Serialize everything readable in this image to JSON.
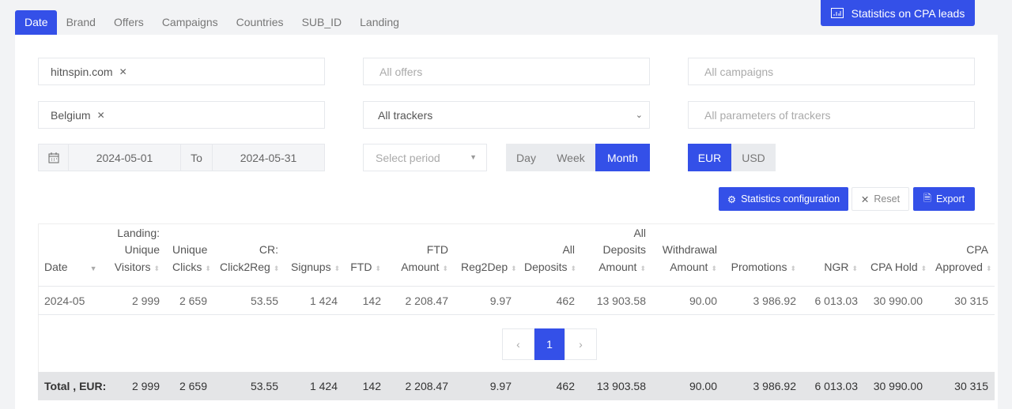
{
  "tabs": [
    "Date",
    "Brand",
    "Offers",
    "Campaigns",
    "Countries",
    "SUB_ID",
    "Landing"
  ],
  "cpa_button": "Statistics on CPA leads",
  "filters": {
    "brand": "hitnspin.com",
    "offers_placeholder": "All offers",
    "campaigns_placeholder": "All campaigns",
    "country": "Belgium",
    "trackers": "All trackers",
    "tracker_params_placeholder": "All parameters of trackers",
    "date_from": "2024-05-01",
    "to_label": "To",
    "date_to": "2024-05-31",
    "period_placeholder": "Select period",
    "granularity": [
      "Day",
      "Week",
      "Month"
    ],
    "granularity_selected": "Month",
    "currency": [
      "EUR",
      "USD"
    ],
    "currency_selected": "EUR"
  },
  "actions": {
    "config": "Statistics configuration",
    "reset": "Reset",
    "export": "Export"
  },
  "table": {
    "headers": [
      [
        "",
        "",
        "Date"
      ],
      [
        "Landing:",
        "Unique",
        "Visitors"
      ],
      [
        "",
        "Unique",
        "Clicks"
      ],
      [
        "",
        "CR:",
        "Click2Reg"
      ],
      [
        "",
        "",
        "Signups"
      ],
      [
        "",
        "",
        "FTD"
      ],
      [
        "",
        "FTD",
        "Amount"
      ],
      [
        "",
        "",
        "Reg2Dep"
      ],
      [
        "",
        "All",
        "Deposits"
      ],
      [
        "All",
        "Deposits",
        "Amount"
      ],
      [
        "",
        "Withdrawal",
        "Amount"
      ],
      [
        "",
        "",
        "Promotions"
      ],
      [
        "",
        "",
        "NGR"
      ],
      [
        "",
        "",
        "CPA Hold"
      ],
      [
        "",
        "CPA",
        "Approved"
      ]
    ],
    "rows": [
      [
        "2024-05",
        "2 999",
        "2 659",
        "53.55",
        "1 424",
        "142",
        "2 208.47",
        "9.97",
        "462",
        "13 903.58",
        "90.00",
        "3 986.92",
        "6 013.03",
        "30 990.00",
        "30 315"
      ]
    ],
    "total": [
      "Total , EUR:",
      "2 999",
      "2 659",
      "53.55",
      "1 424",
      "142",
      "2 208.47",
      "9.97",
      "462",
      "13 903.58",
      "90.00",
      "3 986.92",
      "6 013.03",
      "30 990.00",
      "30 315"
    ]
  },
  "pagination": {
    "prev": "‹",
    "current": "1",
    "next": "›"
  },
  "colors": {
    "accent": "#3450e8"
  }
}
